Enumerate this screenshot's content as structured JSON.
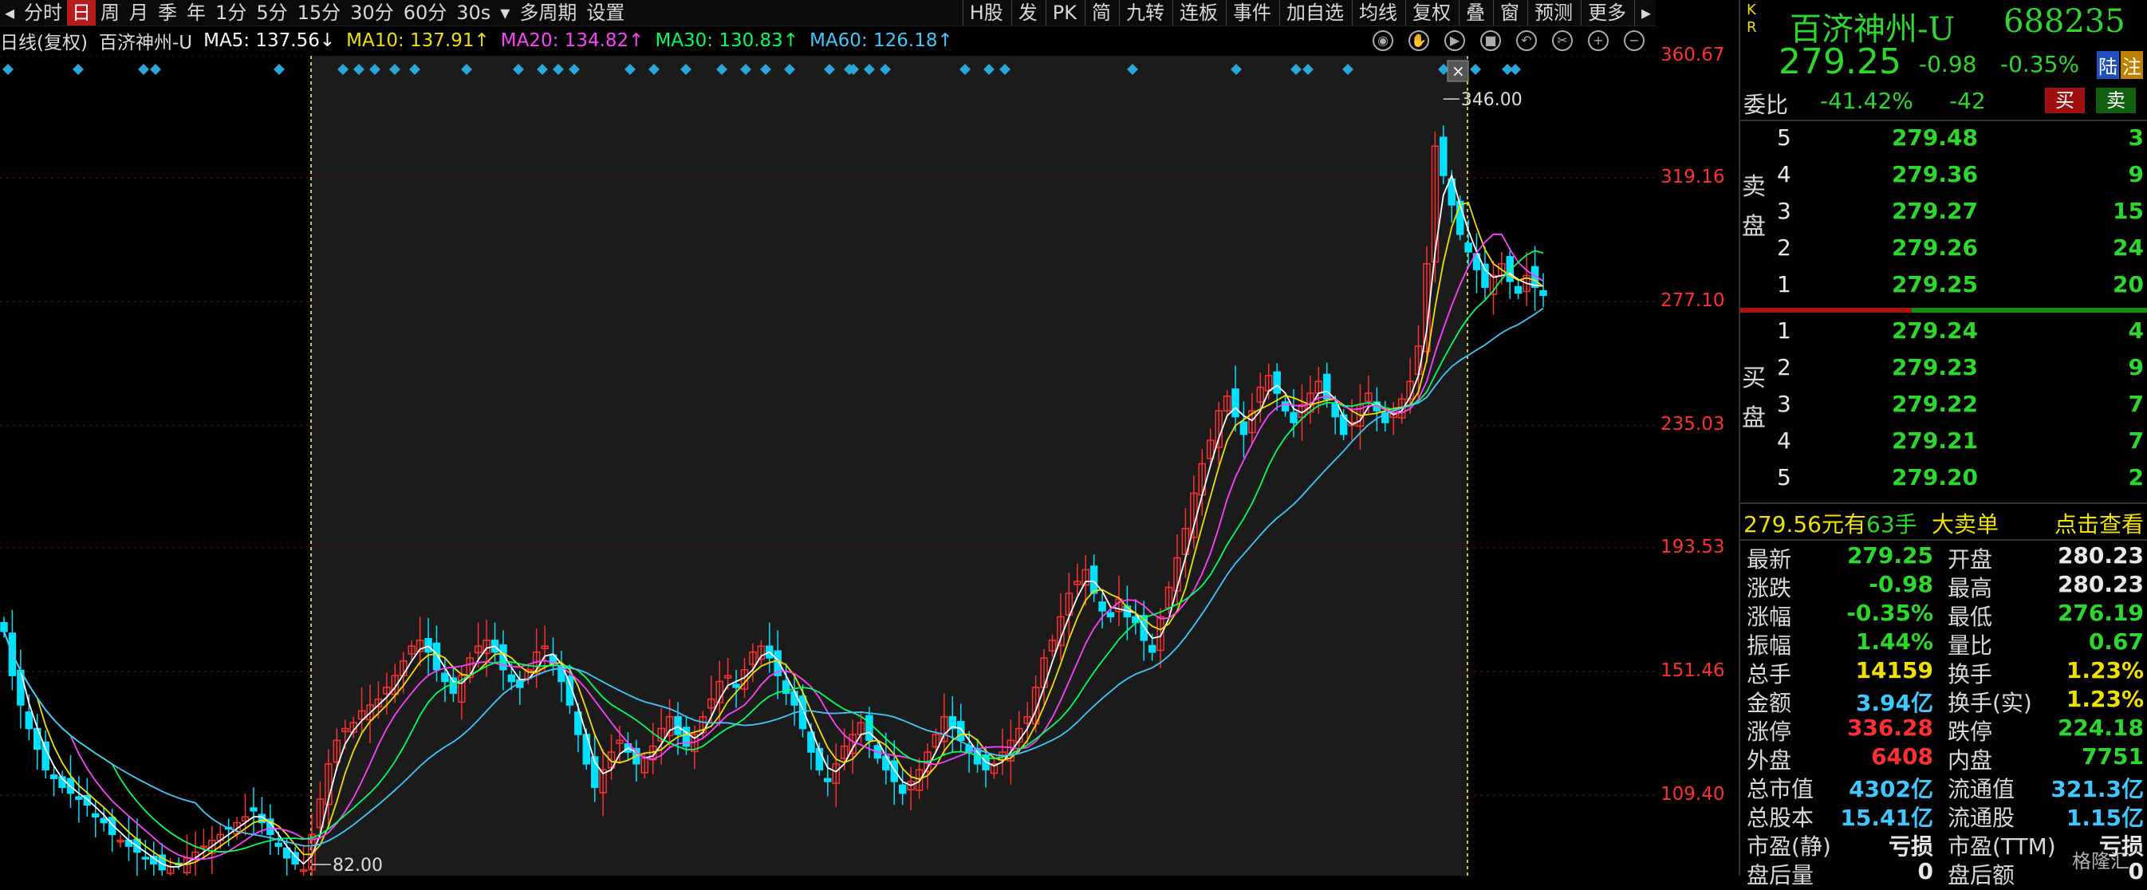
{
  "toolbar": {
    "left_items": [
      "分时",
      "日",
      "周",
      "月",
      "季",
      "年",
      "1分",
      "5分",
      "15分",
      "30分",
      "60分",
      "30s",
      "多周期",
      "设置"
    ],
    "active": "日",
    "right_items": [
      "H股",
      "发",
      "PK",
      "简",
      "九转",
      "连板",
      "事件",
      "加自选",
      "均线",
      "复权",
      "叠",
      "窗",
      "预测",
      "更多"
    ]
  },
  "ma_bar": {
    "period": "日线(复权)",
    "stock": "百济神州-U",
    "ma5": "MA5: 137.56↓",
    "ma10": "MA10: 137.91↑",
    "ma20": "MA20: 134.82↑",
    "ma30": "MA30: 130.83↑",
    "ma60": "MA60: 126.18↑"
  },
  "chart_data": {
    "type": "candlestick",
    "ylim": [
      82.0,
      360.67
    ],
    "yticks": [
      "360.67",
      "319.16",
      "277.10",
      "235.03",
      "193.53",
      "151.46",
      "109.40"
    ],
    "high_label": "346.00",
    "low_label": "82.00",
    "ma_colors": {
      "ma5": "#ffffff",
      "ma10": "#f0e000",
      "ma20": "#ff40ff",
      "ma30": "#00ff60",
      "ma60": "#3ec8ff"
    },
    "up_color": "#ff3030",
    "down_color": "#00e0ff",
    "closes": [
      165,
      150,
      140,
      132,
      125,
      118,
      115,
      112,
      110,
      108,
      106,
      102,
      100,
      96,
      94,
      92,
      90,
      88,
      86,
      84,
      85,
      86,
      88,
      90,
      92,
      94,
      96,
      98,
      100,
      102,
      104,
      100,
      96,
      92,
      88,
      86,
      84,
      96,
      108,
      120,
      128,
      132,
      134,
      138,
      140,
      142,
      146,
      150,
      155,
      160,
      162,
      158,
      152,
      148,
      144,
      150,
      156,
      160,
      162,
      158,
      152,
      148,
      146,
      152,
      158,
      160,
      154,
      148,
      140,
      130,
      120,
      112,
      118,
      124,
      128,
      124,
      120,
      122,
      126,
      132,
      136,
      130,
      126,
      130,
      136,
      142,
      148,
      150,
      146,
      152,
      158,
      160,
      156,
      150,
      144,
      140,
      132,
      124,
      118,
      114,
      120,
      126,
      130,
      134,
      128,
      122,
      118,
      114,
      110,
      114,
      118,
      124,
      130,
      136,
      132,
      128,
      124,
      120,
      118,
      120,
      124,
      128,
      132,
      136,
      146,
      156,
      162,
      170,
      178,
      182,
      186,
      178,
      172,
      170,
      176,
      170,
      168,
      162,
      158,
      170,
      180,
      190,
      200,
      212,
      222,
      230,
      240,
      245,
      238,
      232,
      240,
      248,
      252,
      246,
      240,
      236,
      242,
      246,
      250,
      244,
      238,
      232,
      236,
      242,
      246,
      240,
      236,
      240,
      244,
      250,
      262,
      290,
      330,
      320,
      310,
      300,
      294,
      288,
      282,
      286,
      290,
      284,
      280,
      286,
      282,
      279.25
    ]
  },
  "quote": {
    "name": "百济神州-U",
    "code": "688235",
    "kr": "K R",
    "price": "279.25",
    "change": "-0.98",
    "pct": "-0.35%",
    "badge_lu": "陆",
    "badge_zhu": "注",
    "weibi_label": "委比",
    "weibi_pct": "-41.42%",
    "weibi_diff": "-42",
    "buy_btn": "买",
    "sell_btn": "卖",
    "sell_label": "卖盘",
    "buy_label": "买盘",
    "asks": [
      {
        "lvl": "5",
        "price": "279.48",
        "vol": "3"
      },
      {
        "lvl": "4",
        "price": "279.36",
        "vol": "9"
      },
      {
        "lvl": "3",
        "price": "279.27",
        "vol": "15"
      },
      {
        "lvl": "2",
        "price": "279.26",
        "vol": "24"
      },
      {
        "lvl": "1",
        "price": "279.25",
        "vol": "20"
      }
    ],
    "bids": [
      {
        "lvl": "1",
        "price": "279.24",
        "vol": "4"
      },
      {
        "lvl": "2",
        "price": "279.23",
        "vol": "9"
      },
      {
        "lvl": "3",
        "price": "279.22",
        "vol": "7"
      },
      {
        "lvl": "4",
        "price": "279.21",
        "vol": "7"
      },
      {
        "lvl": "5",
        "price": "279.20",
        "vol": "2"
      }
    ],
    "big": {
      "price": "279.56元有",
      "qty": "63手",
      "kind": "大卖单",
      "link": "点击查看"
    },
    "stats": [
      {
        "l1": "最新",
        "v1": "279.25",
        "c1": "green",
        "l2": "开盘",
        "v2": "280.23",
        "c2": "white"
      },
      {
        "l1": "涨跌",
        "v1": "-0.98",
        "c1": "green",
        "l2": "最高",
        "v2": "280.23",
        "c2": "white"
      },
      {
        "l1": "涨幅",
        "v1": "-0.35%",
        "c1": "green",
        "l2": "最低",
        "v2": "276.19",
        "c2": "green"
      },
      {
        "l1": "振幅",
        "v1": "1.44%",
        "c1": "green",
        "l2": "量比",
        "v2": "0.67",
        "c2": "green"
      },
      {
        "l1": "总手",
        "v1": "14159",
        "c1": "yellow",
        "l2": "换手",
        "v2": "1.23%",
        "c2": "yellow"
      },
      {
        "l1": "金额",
        "v1": "3.94亿",
        "c1": "cyan",
        "l2": "换手(实)",
        "v2": "1.23%",
        "c2": "yellow"
      },
      {
        "l1": "涨停",
        "v1": "336.28",
        "c1": "red",
        "l2": "跌停",
        "v2": "224.18",
        "c2": "green"
      },
      {
        "l1": "外盘",
        "v1": "6408",
        "c1": "red",
        "l2": "内盘",
        "v2": "7751",
        "c2": "green"
      },
      {
        "l1": "总市值",
        "v1": "4302亿",
        "c1": "cyan",
        "l2": "流通值",
        "v2": "321.3亿",
        "c2": "cyan"
      },
      {
        "l1": "总股本",
        "v1": "15.41亿",
        "c1": "cyan",
        "l2": "流通股",
        "v2": "1.15亿",
        "c2": "cyan"
      },
      {
        "l1": "市盈(静)",
        "v1": "亏损",
        "c1": "white",
        "l2": "市盈(TTM)",
        "v2": "亏损",
        "c2": "white"
      },
      {
        "l1": "盘后量",
        "v1": "0",
        "c1": "white",
        "l2": "盘后额",
        "v2": "0",
        "c2": "white"
      }
    ],
    "watermark": "格隆汇"
  }
}
